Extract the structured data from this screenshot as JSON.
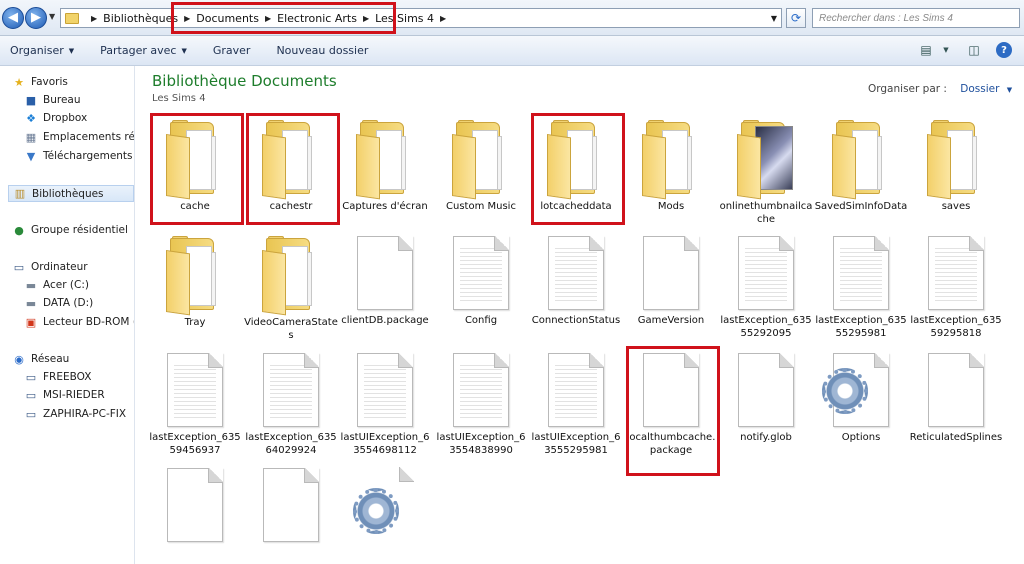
{
  "address": {
    "crumbs": [
      "Bibliothèques",
      "Documents",
      "Electronic Arts",
      "Les Sims 4"
    ],
    "search_placeholder": "Rechercher dans : Les Sims 4"
  },
  "toolbar": {
    "organize": "Organiser",
    "share": "Partager avec",
    "burn": "Graver",
    "new_folder": "Nouveau dossier"
  },
  "sidebar": {
    "favorites": "Favoris",
    "desktop": "Bureau",
    "dropbox": "Dropbox",
    "recent": "Emplacements récents",
    "downloads": "Téléchargements",
    "libraries": "Bibliothèques",
    "homegroup": "Groupe résidentiel",
    "computer": "Ordinateur",
    "drive_c": "Acer (C:)",
    "drive_d": "DATA (D:)",
    "drive_bd": "Lecteur BD-ROM (L:)",
    "network": "Réseau",
    "net1": "FREEBOX",
    "net2": "MSI-RIEDER",
    "net3": "ZAPHIRA-PC-FIX"
  },
  "main": {
    "title": "Bibliothèque Documents",
    "subtitle": "Les Sims 4",
    "arrange_label": "Organiser par :",
    "arrange_value": "Dossier"
  },
  "items": [
    {
      "name": "cache",
      "kind": "folder",
      "highlighted": true
    },
    {
      "name": "cachestr",
      "kind": "folder",
      "highlighted": true
    },
    {
      "name": "Captures d'écran",
      "kind": "folder"
    },
    {
      "name": "Custom Music",
      "kind": "folder"
    },
    {
      "name": "lotcacheddata",
      "kind": "folder",
      "highlighted": true
    },
    {
      "name": "Mods",
      "kind": "folder"
    },
    {
      "name": "onlinethumbnailcache",
      "kind": "folder-thumb"
    },
    {
      "name": "SavedSimInfoData",
      "kind": "folder"
    },
    {
      "name": "saves",
      "kind": "folder"
    },
    {
      "name": "Tray",
      "kind": "folder"
    },
    {
      "name": "VideoCameraStates",
      "kind": "folder"
    },
    {
      "name": "clientDB.package",
      "kind": "doc"
    },
    {
      "name": "Config",
      "kind": "doc-lines"
    },
    {
      "name": "ConnectionStatus",
      "kind": "doc-lines"
    },
    {
      "name": "GameVersion",
      "kind": "doc"
    },
    {
      "name": "lastException_63555292095",
      "kind": "doc-lines"
    },
    {
      "name": "lastException_63555295981",
      "kind": "doc-lines"
    },
    {
      "name": "lastException_63559295818",
      "kind": "doc-lines"
    },
    {
      "name": "lastException_63559456937",
      "kind": "doc-lines"
    },
    {
      "name": "lastException_63564029924",
      "kind": "doc-lines"
    },
    {
      "name": "lastUIException_63554698112",
      "kind": "doc-lines"
    },
    {
      "name": "lastUIException_63554838990",
      "kind": "doc-lines"
    },
    {
      "name": "lastUIException_63555295981",
      "kind": "doc-lines"
    },
    {
      "name": "localthumbcache.package",
      "kind": "doc",
      "highlighted": true
    },
    {
      "name": "notify.glob",
      "kind": "doc"
    },
    {
      "name": "Options",
      "kind": "doc-gear"
    },
    {
      "name": "ReticulatedSplines",
      "kind": "doc"
    },
    {
      "name": "",
      "kind": "doc"
    },
    {
      "name": "",
      "kind": "doc"
    },
    {
      "name": "",
      "kind": "gear"
    }
  ]
}
